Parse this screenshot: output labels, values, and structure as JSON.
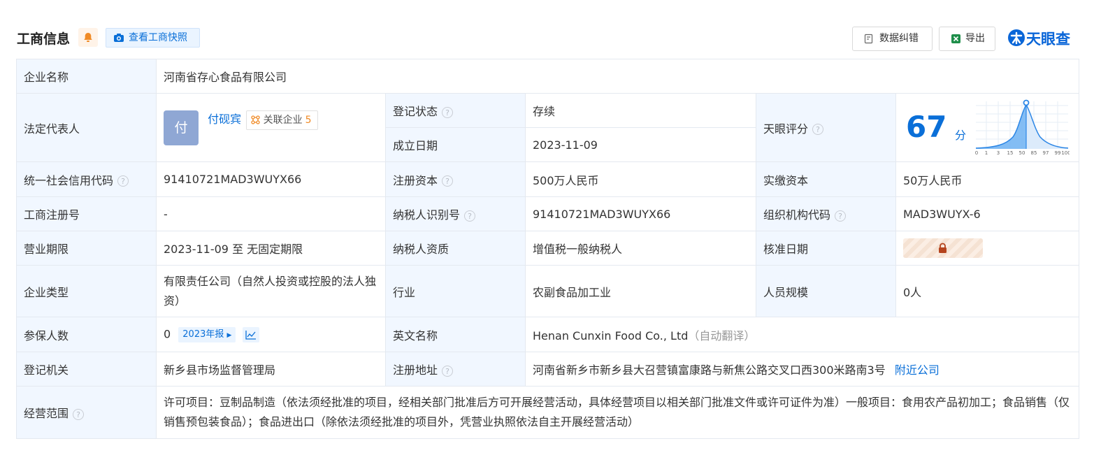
{
  "header": {
    "title": "工商信息",
    "snapshot_btn": "查看工商快照",
    "correct_btn": "数据纠错",
    "export_btn": "导出",
    "brand": "天眼查"
  },
  "company": {
    "name_label": "企业名称",
    "name": "河南省存心食品有限公司",
    "legal_rep_label": "法定代表人",
    "legal_rep_avatar": "付",
    "legal_rep_name": "付砚宾",
    "related_label": "关联企业",
    "related_count": "5",
    "reg_status_label": "登记状态",
    "reg_status": "存续",
    "found_date_label": "成立日期",
    "found_date": "2023-11-09",
    "tianyan_score_label": "天眼评分",
    "score": "67",
    "score_unit": "分",
    "score_axis": [
      "0",
      "1",
      "3",
      "15",
      "50",
      "85",
      "97",
      "99",
      "100"
    ],
    "credit_code_label": "统一社会信用代码",
    "credit_code": "91410721MAD3WUYX66",
    "reg_capital_label": "注册资本",
    "reg_capital": "500万人民币",
    "paid_capital_label": "实缴资本",
    "paid_capital": "50万人民币",
    "biz_reg_no_label": "工商注册号",
    "biz_reg_no": "-",
    "taxpayer_id_label": "纳税人识别号",
    "taxpayer_id": "91410721MAD3WUYX66",
    "org_code_label": "组织机构代码",
    "org_code": "MAD3WUYX-6",
    "term_label": "营业期限",
    "term": "2023-11-09 至 无固定期限",
    "taxpayer_qual_label": "纳税人资质",
    "taxpayer_qual": "增值税一般纳税人",
    "approve_date_label": "核准日期",
    "type_label": "企业类型",
    "type": "有限责任公司（自然人投资或控股的法人独资）",
    "industry_label": "行业",
    "industry": "农副食品加工业",
    "staff_size_label": "人员规模",
    "staff_size": "0人",
    "insured_label": "参保人数",
    "insured": "0",
    "insured_year": "2023年报",
    "english_name_label": "英文名称",
    "english_name": "Henan Cunxin Food Co., Ltd",
    "auto_translate": "（自动翻译）",
    "reg_authority_label": "登记机关",
    "reg_authority": "新乡县市场监督管理局",
    "reg_address_label": "注册地址",
    "reg_address": "河南省新乡市新乡县大召营镇富康路与新焦公路交叉口西300米路南3号",
    "nearby_link": "附近公司",
    "scope_label": "经营范围",
    "scope": "许可项目：豆制品制造（依法须经批准的项目，经相关部门批准后方可开展经营活动，具体经营项目以相关部门批准文件或许可证件为准）一般项目：食用农产品初加工；食品销售（仅销售预包装食品）；食品进出口（除依法须经批准的项目外，凭营业执照依法自主开展经营活动）"
  },
  "colors": {
    "accent": "#0a6fd8",
    "status_green": "#17a34a",
    "label_bg": "#f1f7ff",
    "border": "#e4e9f0"
  }
}
